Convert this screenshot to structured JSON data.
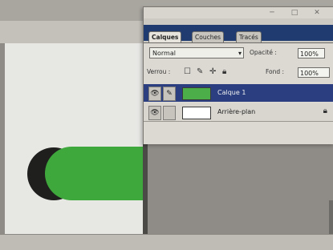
{
  "window": {
    "buttons": [
      "─",
      "□",
      "✕"
    ]
  },
  "layers_panel": {
    "tabs": [
      {
        "label": "Calques",
        "active": true
      },
      {
        "label": "Couches",
        "active": false
      },
      {
        "label": "Tracés",
        "active": false
      }
    ],
    "blend_mode": "Normal",
    "opacity_label": "Opacité :",
    "opacity_value": "100%",
    "lock_label": "Verrou :",
    "fill_label": "Fond :",
    "fill_value": "100%",
    "layers": [
      {
        "name": "Calque 1",
        "selected": true,
        "thumbnail_color": "#4cae49"
      },
      {
        "name": "Arrière-plan",
        "selected": false,
        "thumbnail_color": "#ffffff",
        "locked": true
      }
    ]
  },
  "colors": {
    "navy_highlight": "#2b3f80",
    "green_shape": "#3fa83c",
    "dark_shape": "#1f1f1e",
    "canvas": "#e7e7e4"
  }
}
